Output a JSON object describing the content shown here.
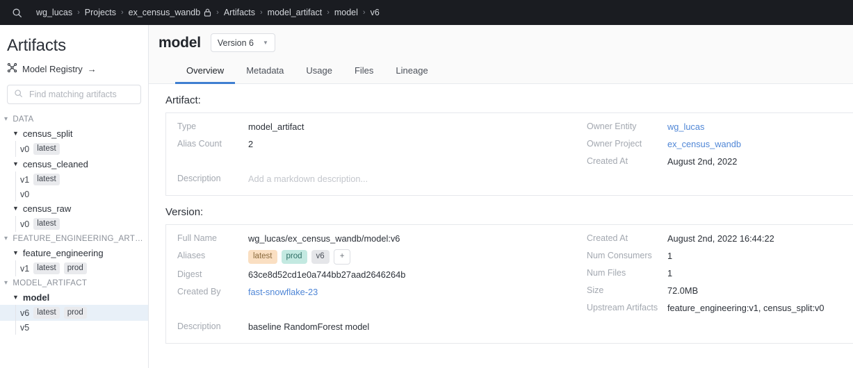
{
  "topbar": {
    "search_icon": "search-icon",
    "breadcrumbs": [
      {
        "label": "wg_lucas",
        "lock": false
      },
      {
        "label": "Projects",
        "lock": false
      },
      {
        "label": "ex_census_wandb",
        "lock": true
      },
      {
        "label": "Artifacts",
        "lock": false
      },
      {
        "label": "model_artifact",
        "lock": false
      },
      {
        "label": "model",
        "lock": false
      },
      {
        "label": "v6",
        "lock": false
      }
    ],
    "separator": "›"
  },
  "sidebar": {
    "title": "Artifacts",
    "registry_link": "Model Registry",
    "registry_arrow": "→",
    "registry_icon": "model-registry-icon",
    "search": {
      "placeholder": "Find matching artifacts",
      "value": "",
      "icon": "search-icon"
    },
    "groups": [
      {
        "label": "DATA",
        "nodes": [
          {
            "name": "census_split",
            "selected": false,
            "versions": [
              {
                "version": "v0",
                "tags": [
                  "latest"
                ],
                "selected": false
              }
            ]
          },
          {
            "name": "census_cleaned",
            "selected": false,
            "versions": [
              {
                "version": "v1",
                "tags": [
                  "latest"
                ],
                "selected": false
              },
              {
                "version": "v0",
                "tags": [],
                "selected": false
              }
            ]
          },
          {
            "name": "census_raw",
            "selected": false,
            "versions": [
              {
                "version": "v0",
                "tags": [
                  "latest"
                ],
                "selected": false
              }
            ]
          }
        ]
      },
      {
        "label": "FEATURE_ENGINEERING_ART…",
        "nodes": [
          {
            "name": "feature_engineering",
            "selected": false,
            "versions": [
              {
                "version": "v1",
                "tags": [
                  "latest",
                  "prod"
                ],
                "selected": false
              }
            ]
          }
        ]
      },
      {
        "label": "MODEL_ARTIFACT",
        "nodes": [
          {
            "name": "model",
            "selected": true,
            "versions": [
              {
                "version": "v6",
                "tags": [
                  "latest",
                  "prod"
                ],
                "selected": true
              },
              {
                "version": "v5",
                "tags": [],
                "selected": false
              }
            ]
          }
        ]
      }
    ]
  },
  "main": {
    "artifact_name": "model",
    "version_select": "Version 6",
    "tabs": [
      {
        "label": "Overview",
        "active": true
      },
      {
        "label": "Metadata",
        "active": false
      },
      {
        "label": "Usage",
        "active": false
      },
      {
        "label": "Files",
        "active": false
      },
      {
        "label": "Lineage",
        "active": false
      }
    ],
    "artifact_section": {
      "heading": "Artifact:",
      "left": {
        "type_label": "Type",
        "type_value": "model_artifact",
        "alias_count_label": "Alias Count",
        "alias_count_value": "2",
        "description_label": "Description",
        "description_placeholder": "Add a markdown description..."
      },
      "right": {
        "owner_entity_label": "Owner Entity",
        "owner_entity_value": "wg_lucas",
        "owner_project_label": "Owner Project",
        "owner_project_value": "ex_census_wandb",
        "created_at_label": "Created At",
        "created_at_value": "August 2nd, 2022"
      }
    },
    "version_section": {
      "heading": "Version:",
      "left": {
        "full_name_label": "Full Name",
        "full_name_value": "wg_lucas/ex_census_wandb/model:v6",
        "aliases_label": "Aliases",
        "aliases": [
          "latest",
          "prod",
          "v6"
        ],
        "add_alias_label": "+",
        "digest_label": "Digest",
        "digest_value": "63ce8d52cd1e0a744bb27aad2646264b",
        "created_by_label": "Created By",
        "created_by_value": "fast-snowflake-23",
        "description_label": "Description",
        "description_value": "baseline RandomForest model"
      },
      "right": {
        "created_at_label": "Created At",
        "created_at_value": "August 2nd, 2022 16:44:22",
        "num_consumers_label": "Num Consumers",
        "num_consumers_value": "1",
        "num_files_label": "Num Files",
        "num_files_value": "1",
        "size_label": "Size",
        "size_value": "72.0MB",
        "upstream_label": "Upstream Artifacts",
        "upstream_value": "feature_engineering:v1, census_split:v0"
      }
    }
  },
  "colors": {
    "topbar_bg": "#1a1c21",
    "accent_tab": "#3f7fd1",
    "link": "#4f86d6",
    "tag_latest_bg": "#fadfc2",
    "tag_prod_bg": "#c3e9e1",
    "tag_v6_bg": "#e5e6e9",
    "selected_row_bg": "#e8f0f8"
  }
}
